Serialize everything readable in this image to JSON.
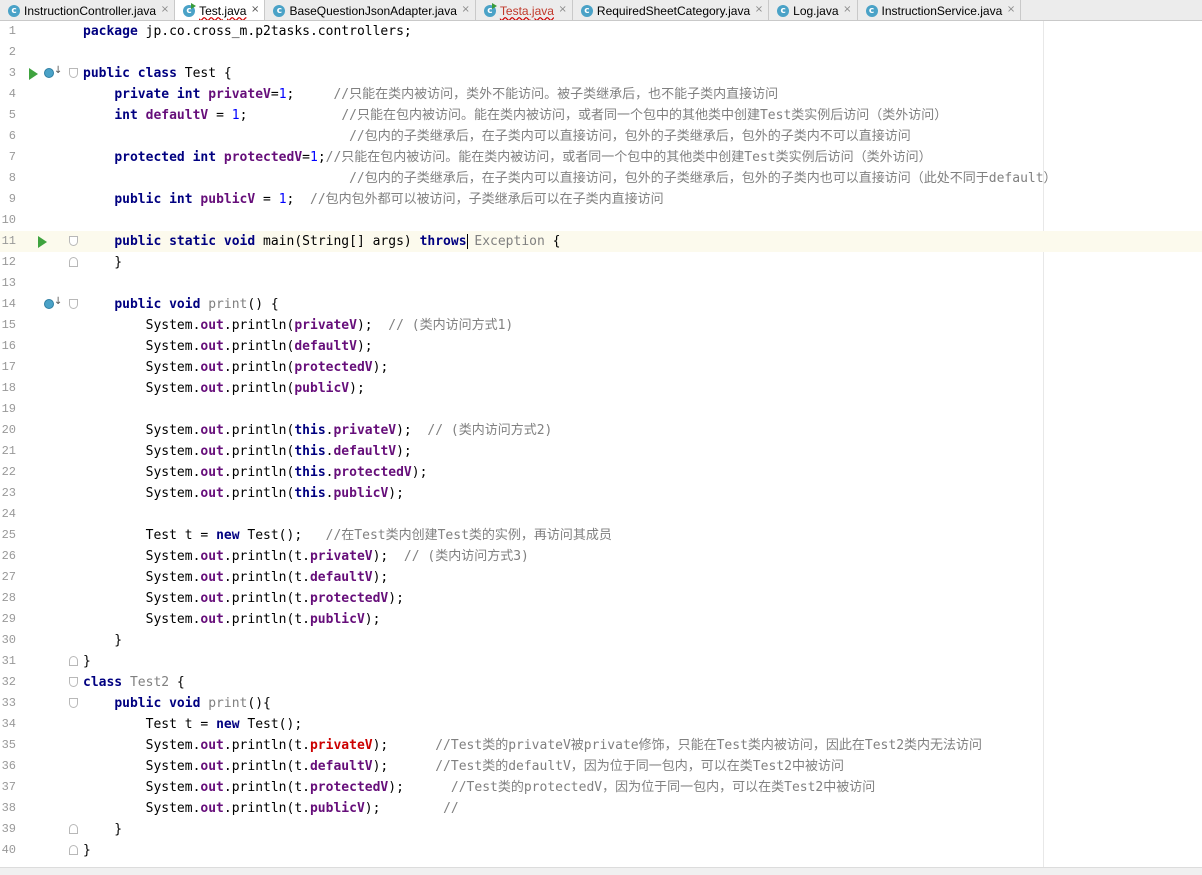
{
  "tabs": [
    {
      "label": "InstructionController.java",
      "state": "normal",
      "icon": "class-icon"
    },
    {
      "label": "Test.java",
      "state": "active",
      "icon": "main-class-icon"
    },
    {
      "label": "BaseQuestionJsonAdapter.java",
      "state": "normal",
      "icon": "class-icon"
    },
    {
      "label": "Testa.java",
      "state": "error",
      "icon": "main-class-icon"
    },
    {
      "label": "RequiredSheetCategory.java",
      "state": "normal",
      "icon": "class-icon"
    },
    {
      "label": "Log.java",
      "state": "normal",
      "icon": "class-icon"
    },
    {
      "label": "InstructionService.java",
      "state": "normal",
      "icon": "class-icon"
    }
  ],
  "tab_close_glyph": "×",
  "tab_icon_letter": "c",
  "editor": {
    "current_line": 11,
    "lines": [
      {
        "n": 1,
        "tokens": [
          [
            "kw",
            "package"
          ],
          [
            "pln",
            " jp.co.cross_m.p2tasks.controllers;"
          ]
        ]
      },
      {
        "n": 2,
        "tokens": []
      },
      {
        "n": 3,
        "gutter": [
          "run",
          "override"
        ],
        "fold": "open",
        "tokens": [
          [
            "kw",
            "public class"
          ],
          [
            "pln",
            " Test {"
          ]
        ]
      },
      {
        "n": 4,
        "tokens": [
          [
            "pln",
            "    "
          ],
          [
            "kw",
            "private int"
          ],
          [
            "pln",
            " "
          ],
          [
            "fld",
            "privateV"
          ],
          [
            "pln",
            "="
          ],
          [
            "num",
            "1"
          ],
          [
            "pln",
            ";     "
          ],
          [
            "cmt",
            "//只能在类内被访问，类外不能访问。被子类继承后，也不能子类内直接访问"
          ]
        ]
      },
      {
        "n": 5,
        "tokens": [
          [
            "pln",
            "    "
          ],
          [
            "kw",
            "int"
          ],
          [
            "pln",
            " "
          ],
          [
            "fld",
            "defaultV"
          ],
          [
            "pln",
            " = "
          ],
          [
            "num",
            "1"
          ],
          [
            "pln",
            ";            "
          ],
          [
            "cmt",
            "//只能在包内被访问。能在类内被访问，或者同一个包中的其他类中创建Test类实例后访问（类外访问）"
          ]
        ]
      },
      {
        "n": 6,
        "tokens": [
          [
            "pln",
            "                                  "
          ],
          [
            "cmt",
            "//包内的子类继承后，在子类内可以直接访问，包外的子类继承后，包外的子类内不可以直接访问"
          ]
        ]
      },
      {
        "n": 7,
        "tokens": [
          [
            "pln",
            "    "
          ],
          [
            "kw",
            "protected int"
          ],
          [
            "pln",
            " "
          ],
          [
            "fld",
            "protectedV"
          ],
          [
            "pln",
            "="
          ],
          [
            "num",
            "1"
          ],
          [
            "pln",
            ";"
          ],
          [
            "cmt",
            "//只能在包内被访问。能在类内被访问，或者同一个包中的其他类中创建Test类实例后访问（类外访问）"
          ]
        ]
      },
      {
        "n": 8,
        "tokens": [
          [
            "pln",
            "                                  "
          ],
          [
            "cmt",
            "//包内的子类继承后，在子类内可以直接访问，包外的子类继承后，包外的子类内也可以直接访问（此处不同于default）"
          ]
        ]
      },
      {
        "n": 9,
        "tokens": [
          [
            "pln",
            "    "
          ],
          [
            "kw",
            "public int"
          ],
          [
            "pln",
            " "
          ],
          [
            "fld",
            "publicV"
          ],
          [
            "pln",
            " = "
          ],
          [
            "num",
            "1"
          ],
          [
            "pln",
            ";  "
          ],
          [
            "cmt",
            "//包内包外都可以被访问，子类继承后可以在子类内直接访问"
          ]
        ]
      },
      {
        "n": 10,
        "tokens": []
      },
      {
        "n": 11,
        "gutter": [
          "run"
        ],
        "fold": "open",
        "caret_before": 5,
        "tokens": [
          [
            "pln",
            "    "
          ],
          [
            "kw",
            "public static void"
          ],
          [
            "pln",
            " "
          ],
          [
            "pln",
            "main(String[] args) "
          ],
          [
            "kw",
            "throws"
          ],
          [
            "pln",
            " "
          ],
          [
            "unused",
            "Exception"
          ],
          [
            "pln",
            " {"
          ]
        ]
      },
      {
        "n": 12,
        "fold": "end",
        "tokens": [
          [
            "pln",
            "    }"
          ]
        ]
      },
      {
        "n": 13,
        "tokens": []
      },
      {
        "n": 14,
        "gutter": [
          "override"
        ],
        "fold": "open",
        "tokens": [
          [
            "pln",
            "    "
          ],
          [
            "kw",
            "public void"
          ],
          [
            "pln",
            " "
          ],
          [
            "unused",
            "print"
          ],
          [
            "pln",
            "() {"
          ]
        ]
      },
      {
        "n": 15,
        "tokens": [
          [
            "pln",
            "        System."
          ],
          [
            "fld",
            "out"
          ],
          [
            "pln",
            ".println("
          ],
          [
            "fld",
            "privateV"
          ],
          [
            "pln",
            ");  "
          ],
          [
            "cmt",
            "// (类内访问方式1)"
          ]
        ]
      },
      {
        "n": 16,
        "tokens": [
          [
            "pln",
            "        System."
          ],
          [
            "fld",
            "out"
          ],
          [
            "pln",
            ".println("
          ],
          [
            "fld",
            "defaultV"
          ],
          [
            "pln",
            ");"
          ]
        ]
      },
      {
        "n": 17,
        "tokens": [
          [
            "pln",
            "        System."
          ],
          [
            "fld",
            "out"
          ],
          [
            "pln",
            ".println("
          ],
          [
            "fld",
            "protectedV"
          ],
          [
            "pln",
            ");"
          ]
        ]
      },
      {
        "n": 18,
        "tokens": [
          [
            "pln",
            "        System."
          ],
          [
            "fld",
            "out"
          ],
          [
            "pln",
            ".println("
          ],
          [
            "fld",
            "publicV"
          ],
          [
            "pln",
            ");"
          ]
        ]
      },
      {
        "n": 19,
        "tokens": []
      },
      {
        "n": 20,
        "tokens": [
          [
            "pln",
            "        System."
          ],
          [
            "fld",
            "out"
          ],
          [
            "pln",
            ".println("
          ],
          [
            "kw",
            "this"
          ],
          [
            "pln",
            "."
          ],
          [
            "fld",
            "privateV"
          ],
          [
            "pln",
            ");  "
          ],
          [
            "cmt",
            "// (类内访问方式2)"
          ]
        ]
      },
      {
        "n": 21,
        "tokens": [
          [
            "pln",
            "        System."
          ],
          [
            "fld",
            "out"
          ],
          [
            "pln",
            ".println("
          ],
          [
            "kw",
            "this"
          ],
          [
            "pln",
            "."
          ],
          [
            "fld",
            "defaultV"
          ],
          [
            "pln",
            ");"
          ]
        ]
      },
      {
        "n": 22,
        "tokens": [
          [
            "pln",
            "        System."
          ],
          [
            "fld",
            "out"
          ],
          [
            "pln",
            ".println("
          ],
          [
            "kw",
            "this"
          ],
          [
            "pln",
            "."
          ],
          [
            "fld",
            "protectedV"
          ],
          [
            "pln",
            ");"
          ]
        ]
      },
      {
        "n": 23,
        "tokens": [
          [
            "pln",
            "        System."
          ],
          [
            "fld",
            "out"
          ],
          [
            "pln",
            ".println("
          ],
          [
            "kw",
            "this"
          ],
          [
            "pln",
            "."
          ],
          [
            "fld",
            "publicV"
          ],
          [
            "pln",
            ");"
          ]
        ]
      },
      {
        "n": 24,
        "tokens": []
      },
      {
        "n": 25,
        "tokens": [
          [
            "pln",
            "        Test t = "
          ],
          [
            "kw",
            "new"
          ],
          [
            "pln",
            " Test();   "
          ],
          [
            "cmt",
            "//在Test类内创建Test类的实例，再访问其成员"
          ]
        ]
      },
      {
        "n": 26,
        "tokens": [
          [
            "pln",
            "        System."
          ],
          [
            "fld",
            "out"
          ],
          [
            "pln",
            ".println(t."
          ],
          [
            "fld",
            "privateV"
          ],
          [
            "pln",
            ");  "
          ],
          [
            "cmt",
            "// (类内访问方式3)"
          ]
        ]
      },
      {
        "n": 27,
        "tokens": [
          [
            "pln",
            "        System."
          ],
          [
            "fld",
            "out"
          ],
          [
            "pln",
            ".println(t."
          ],
          [
            "fld",
            "defaultV"
          ],
          [
            "pln",
            ");"
          ]
        ]
      },
      {
        "n": 28,
        "tokens": [
          [
            "pln",
            "        System."
          ],
          [
            "fld",
            "out"
          ],
          [
            "pln",
            ".println(t."
          ],
          [
            "fld",
            "protectedV"
          ],
          [
            "pln",
            ");"
          ]
        ]
      },
      {
        "n": 29,
        "tokens": [
          [
            "pln",
            "        System."
          ],
          [
            "fld",
            "out"
          ],
          [
            "pln",
            ".println(t."
          ],
          [
            "fld",
            "publicV"
          ],
          [
            "pln",
            ");"
          ]
        ]
      },
      {
        "n": 30,
        "tokens": [
          [
            "pln",
            "    }"
          ]
        ]
      },
      {
        "n": 31,
        "fold": "end",
        "tokens": [
          [
            "pln",
            "}"
          ]
        ]
      },
      {
        "n": 32,
        "fold": "open",
        "tokens": [
          [
            "kw",
            "class"
          ],
          [
            "pln",
            " "
          ],
          [
            "unused",
            "Test2"
          ],
          [
            "pln",
            " {"
          ]
        ]
      },
      {
        "n": 33,
        "fold": "open",
        "tokens": [
          [
            "pln",
            "    "
          ],
          [
            "kw",
            "public void"
          ],
          [
            "pln",
            " "
          ],
          [
            "unused",
            "print"
          ],
          [
            "pln",
            "(){"
          ]
        ]
      },
      {
        "n": 34,
        "tokens": [
          [
            "pln",
            "        Test t = "
          ],
          [
            "kw",
            "new"
          ],
          [
            "pln",
            " Test();"
          ]
        ]
      },
      {
        "n": 35,
        "tokens": [
          [
            "pln",
            "        System."
          ],
          [
            "fld",
            "out"
          ],
          [
            "pln",
            ".println(t."
          ],
          [
            "fld-err",
            "privateV"
          ],
          [
            "pln",
            ");      "
          ],
          [
            "cmt",
            "//Test类的privateV被private修饰，只能在Test类内被访问，因此在Test2类内无法访问"
          ]
        ]
      },
      {
        "n": 36,
        "tokens": [
          [
            "pln",
            "        System."
          ],
          [
            "fld",
            "out"
          ],
          [
            "pln",
            ".println(t."
          ],
          [
            "fld",
            "defaultV"
          ],
          [
            "pln",
            ");      "
          ],
          [
            "cmt",
            "//Test类的defaultV，因为位于同一包内，可以在类Test2中被访问"
          ]
        ]
      },
      {
        "n": 37,
        "tokens": [
          [
            "pln",
            "        System."
          ],
          [
            "fld",
            "out"
          ],
          [
            "pln",
            ".println(t."
          ],
          [
            "fld",
            "protectedV"
          ],
          [
            "pln",
            ");      "
          ],
          [
            "cmt",
            "//Test类的protectedV，因为位于同一包内，可以在类Test2中被访问"
          ]
        ]
      },
      {
        "n": 38,
        "tokens": [
          [
            "pln",
            "        System."
          ],
          [
            "fld",
            "out"
          ],
          [
            "pln",
            ".println(t."
          ],
          [
            "fld",
            "publicV"
          ],
          [
            "pln",
            ");        "
          ],
          [
            "cmt",
            "//"
          ]
        ]
      },
      {
        "n": 39,
        "fold": "end",
        "tokens": [
          [
            "pln",
            "    }"
          ]
        ]
      },
      {
        "n": 40,
        "fold": "end",
        "tokens": [
          [
            "pln",
            "}"
          ]
        ]
      }
    ]
  }
}
